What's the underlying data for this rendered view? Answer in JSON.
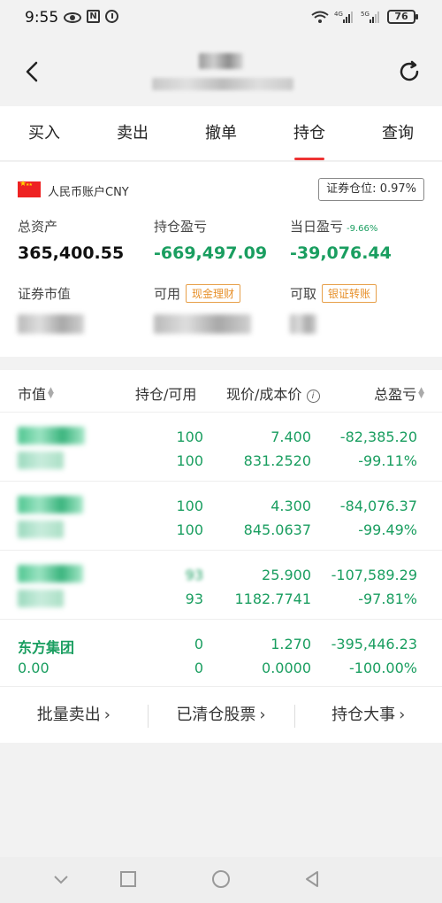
{
  "status_bar": {
    "time": "9:55",
    "battery": "76",
    "net1": "4G",
    "net2": "5G"
  },
  "tabs": [
    {
      "label": "买入",
      "active": false
    },
    {
      "label": "卖出",
      "active": false
    },
    {
      "label": "撤单",
      "active": false
    },
    {
      "label": "持仓",
      "active": true
    },
    {
      "label": "查询",
      "active": false
    }
  ],
  "account": {
    "currency_label": "人民币账户CNY",
    "position_label": "证券仓位:",
    "position_value": "0.97%",
    "total_assets_label": "总资产",
    "total_assets_value": "365,400.55",
    "holding_pl_label": "持仓盈亏",
    "holding_pl_value": "-669,497.09",
    "daily_pl_label": "当日盈亏",
    "daily_pl_pct": "-9.66%",
    "daily_pl_value": "-39,076.44",
    "market_value_label": "证券市值",
    "available_label": "可用",
    "cash_mgmt_button": "现金理财",
    "withdrawable_label": "可取",
    "bank_transfer_button": "银证转账"
  },
  "table": {
    "headers": {
      "market_value": "市值",
      "position": "持仓/可用",
      "price": "现价/成本价",
      "pl": "总盈亏"
    },
    "rows": [
      {
        "name": "",
        "value": "",
        "qty": "100",
        "avail": "100",
        "price": "7.400",
        "cost": "831.2520",
        "pl": "-82,385.20",
        "pl_pct": "-99.11%"
      },
      {
        "name": "",
        "value": "",
        "qty": "100",
        "avail": "100",
        "price": "4.300",
        "cost": "845.0637",
        "pl": "-84,076.37",
        "pl_pct": "-99.49%"
      },
      {
        "name": "",
        "value": "",
        "qty": "93",
        "avail": "93",
        "price": "25.900",
        "cost": "1182.7741",
        "pl": "-107,589.29",
        "pl_pct": "-97.81%"
      },
      {
        "name": "东方集团",
        "value": "0.00",
        "qty": "0",
        "avail": "0",
        "price": "1.270",
        "cost": "0.0000",
        "pl": "-395,446.23",
        "pl_pct": "-100.00%"
      }
    ]
  },
  "actions": {
    "batch_sell": "批量卖出",
    "cleared_stocks": "已清仓股票",
    "holding_events": "持仓大事"
  },
  "colors": {
    "loss_green": "#1a9e60",
    "tab_indicator": "#e33333",
    "tag_orange": "#e7902a"
  }
}
